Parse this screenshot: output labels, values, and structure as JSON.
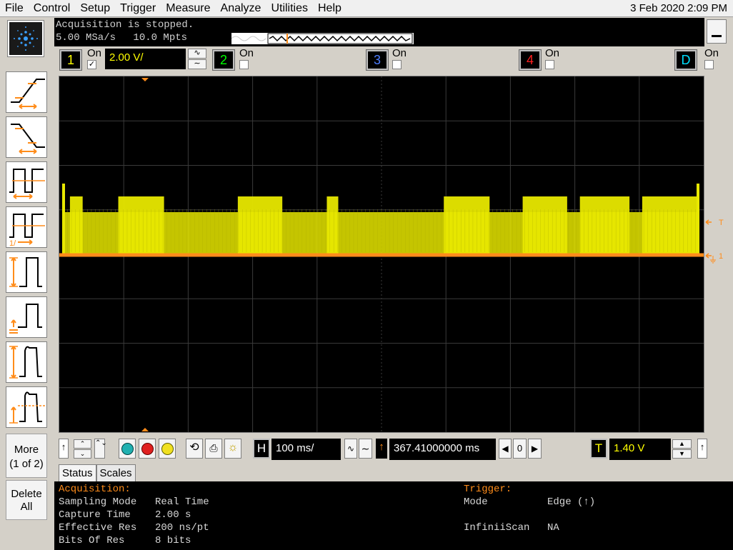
{
  "menu": [
    "File",
    "Control",
    "Setup",
    "Trigger",
    "Measure",
    "Analyze",
    "Utilities",
    "Help"
  ],
  "datetime": "3 Feb 2020  2:09 PM",
  "acquisition": {
    "status_text": "Acquisition is stopped.",
    "sample_rate": "5.00 MSa/s",
    "memory_depth": "10.0 Mpts"
  },
  "channels": [
    {
      "num": "1",
      "on_label": "On",
      "checked": true,
      "color": "#ffff00"
    },
    {
      "num": "2",
      "on_label": "On",
      "checked": false,
      "color": "#00ff00"
    },
    {
      "num": "3",
      "on_label": "On",
      "checked": false,
      "color": "#4d7dff"
    },
    {
      "num": "4",
      "on_label": "On",
      "checked": false,
      "color": "#ff2020"
    },
    {
      "num": "D",
      "on_label": "On",
      "checked": false,
      "color": "#00e0ff"
    }
  ],
  "ch1_scale": "2.00 V/",
  "left_toolbar": {
    "more_label": "More",
    "more_sub": "(1 of 2)",
    "delete_label": "Delete",
    "delete_sub": "All"
  },
  "markers": {
    "trigger_marker": "T",
    "ground_marker": "1"
  },
  "horizontal": {
    "h_label": "H",
    "time_scale": "100 ms/",
    "delay": "367.41000000 ms",
    "delay_ref": "0"
  },
  "trigger": {
    "t_label": "T",
    "level": "1.40 V"
  },
  "tabs": [
    "Status",
    "Scales"
  ],
  "status": {
    "acq_header": "Acquisition:",
    "trig_header": "Trigger:",
    "rows": [
      {
        "label": "Sampling Mode",
        "value": "Real Time"
      },
      {
        "label": "Capture Time",
        "value": "2.00 s"
      },
      {
        "label": "Effective Res",
        "value": "200 ns/pt"
      },
      {
        "label": "Bits Of Res",
        "value": "8 bits"
      }
    ],
    "trig_rows": [
      {
        "label": "Mode",
        "value": "Edge (↑)"
      },
      {
        "label": "InfiniiScan",
        "value": "NA"
      }
    ]
  },
  "colors": {
    "ch1_trace": "#e8e800",
    "ground_trace": "#ff8c1a",
    "accent_orange": "#ff8c1a",
    "screen_bg": "#000000"
  },
  "waveform": {
    "high_segments_ms": [
      [
        50,
        150
      ],
      [
        430,
        790
      ],
      [
        1370,
        1720
      ],
      [
        2070,
        2160
      ],
      [
        2990,
        3350
      ],
      [
        3610,
        3960
      ],
      [
        4060,
        4450
      ],
      [
        4550,
        4990
      ]
    ]
  }
}
